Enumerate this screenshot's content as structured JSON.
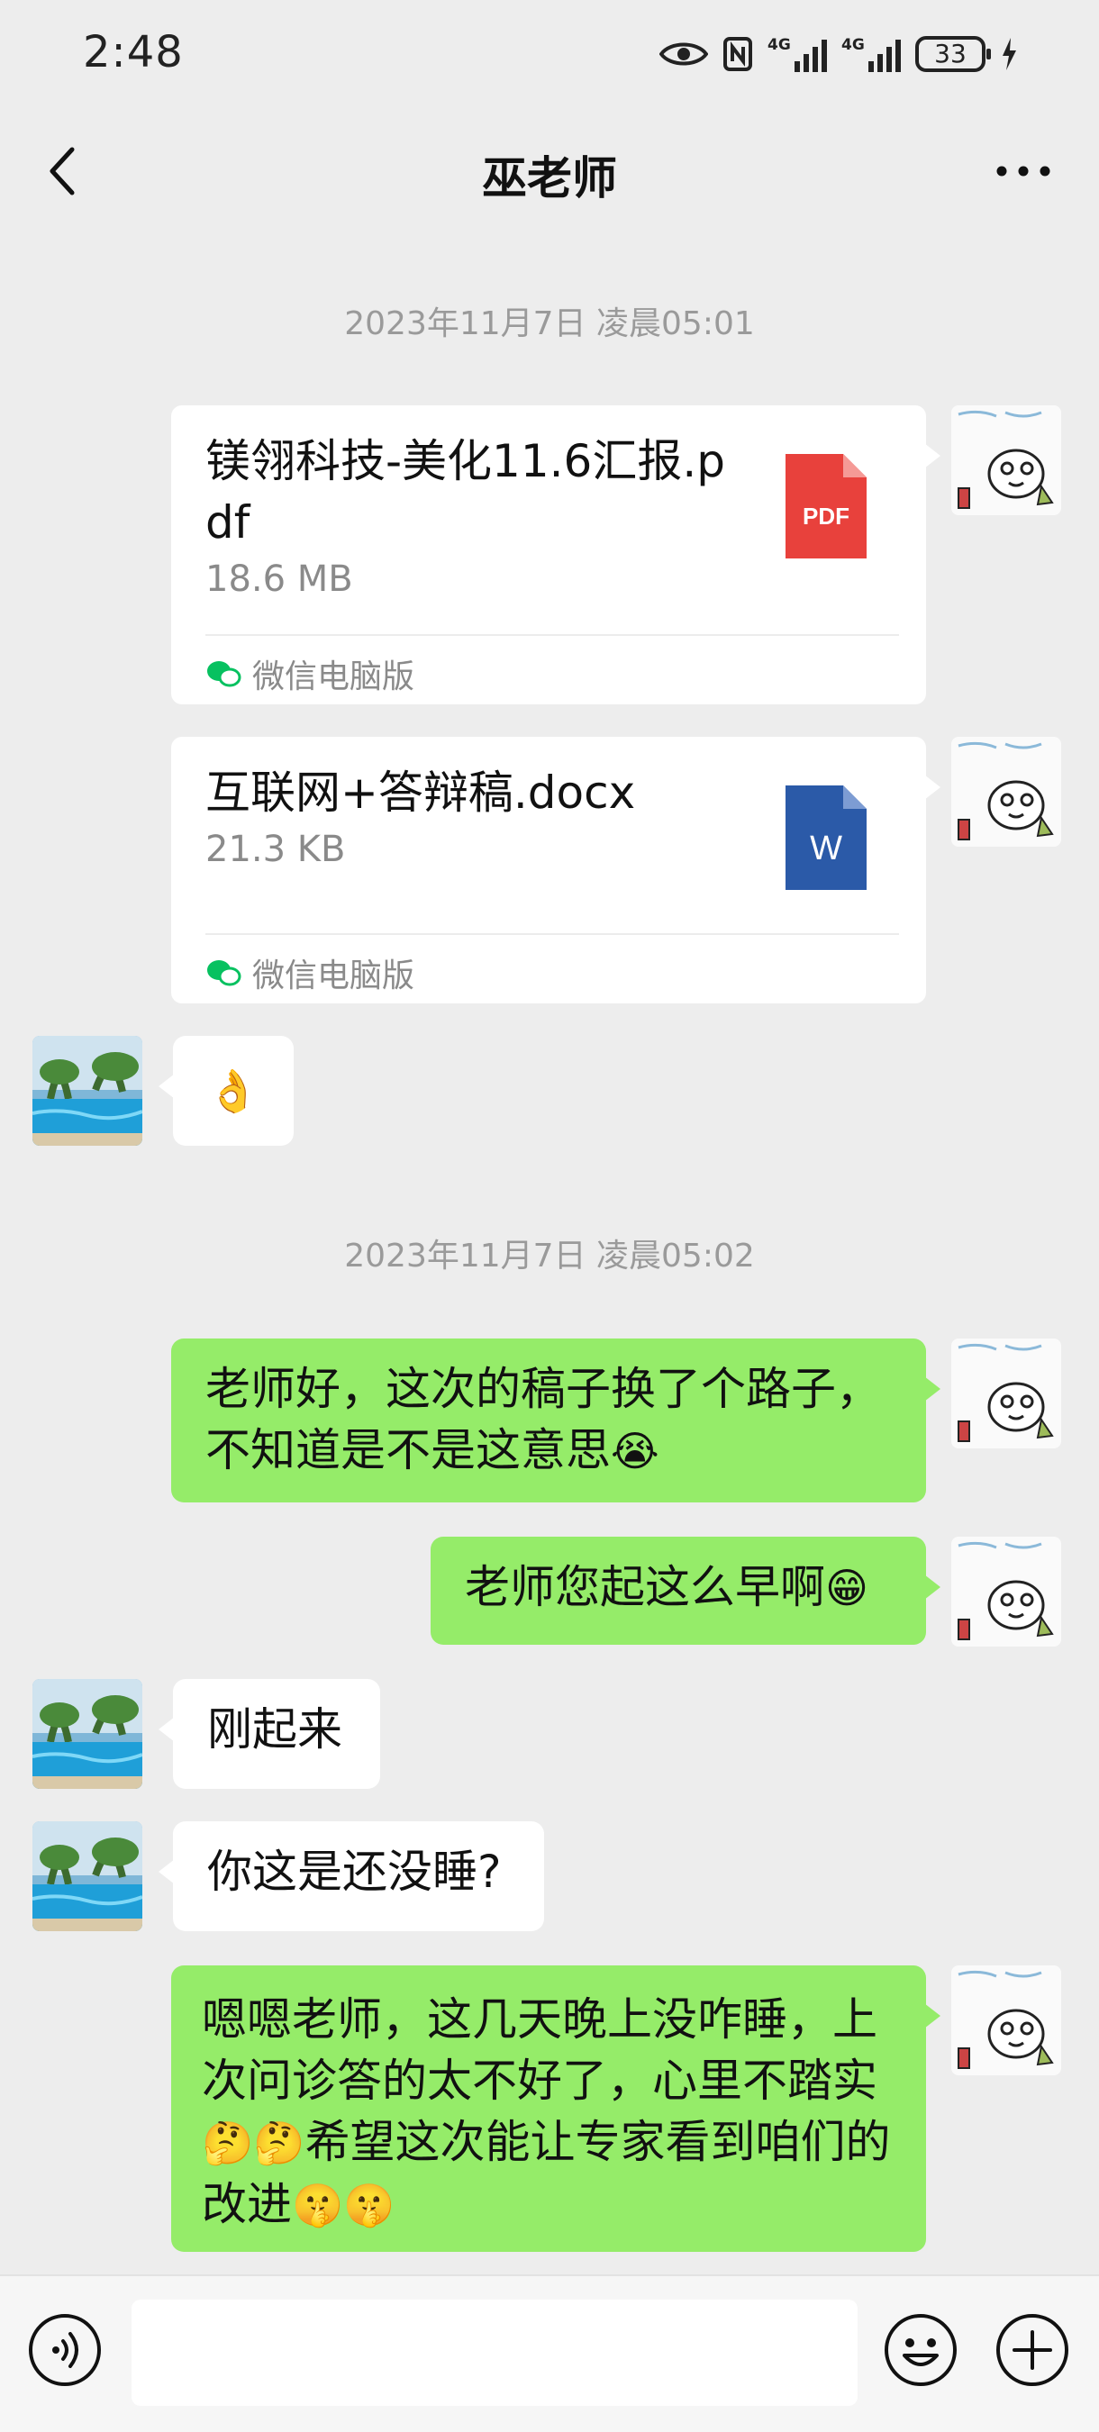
{
  "status_bar": {
    "time": "2:48",
    "network_1": "4G",
    "network_2": "4G",
    "battery": "33"
  },
  "header": {
    "title": "巫老师"
  },
  "colors": {
    "background": "#ededed",
    "outgoing_bubble": "#95ec69",
    "incoming_bubble": "#ffffff",
    "pdf_red": "#e8413c",
    "word_blue": "#2b5aa8",
    "wechat_green": "#07c160"
  },
  "messages": {
    "timestamp_1": "2023年11月7日 凌晨05:01",
    "file_1": {
      "name": "镁翎科技-美化11.6汇报.pdf",
      "size": "18.6 MB",
      "type_label": "PDF",
      "source": "微信电脑版",
      "icon": "pdf-file-icon"
    },
    "file_2": {
      "name": "互联网+答辩稿.docx",
      "size": "21.3 KB",
      "type_label": "W",
      "source": "微信电脑版",
      "icon": "word-file-icon"
    },
    "reply_ok": "👌",
    "timestamp_2": "2023年11月7日 凌晨05:02",
    "msg_1": "老师好，这次的稿子换了个路子，不知道是不是这意思",
    "msg_1_emoji": "😭",
    "msg_2": "老师您起这么早啊",
    "msg_2_emoji": "😁",
    "reply_1": "刚起来",
    "reply_2": "你这是还没睡?",
    "msg_3_a": "嗯嗯老师，这几天晚上没咋睡，上次问诊答的太不好了，心里不踏实",
    "msg_3_emoji_a": "🤔🤔",
    "msg_3_b": "希望这次能让专家看到咱们的改进",
    "msg_3_emoji_b": "🤫🤫"
  },
  "input_bar": {
    "placeholder": "",
    "icons": [
      "voice-icon",
      "emoji-icon",
      "plus-icon"
    ]
  }
}
